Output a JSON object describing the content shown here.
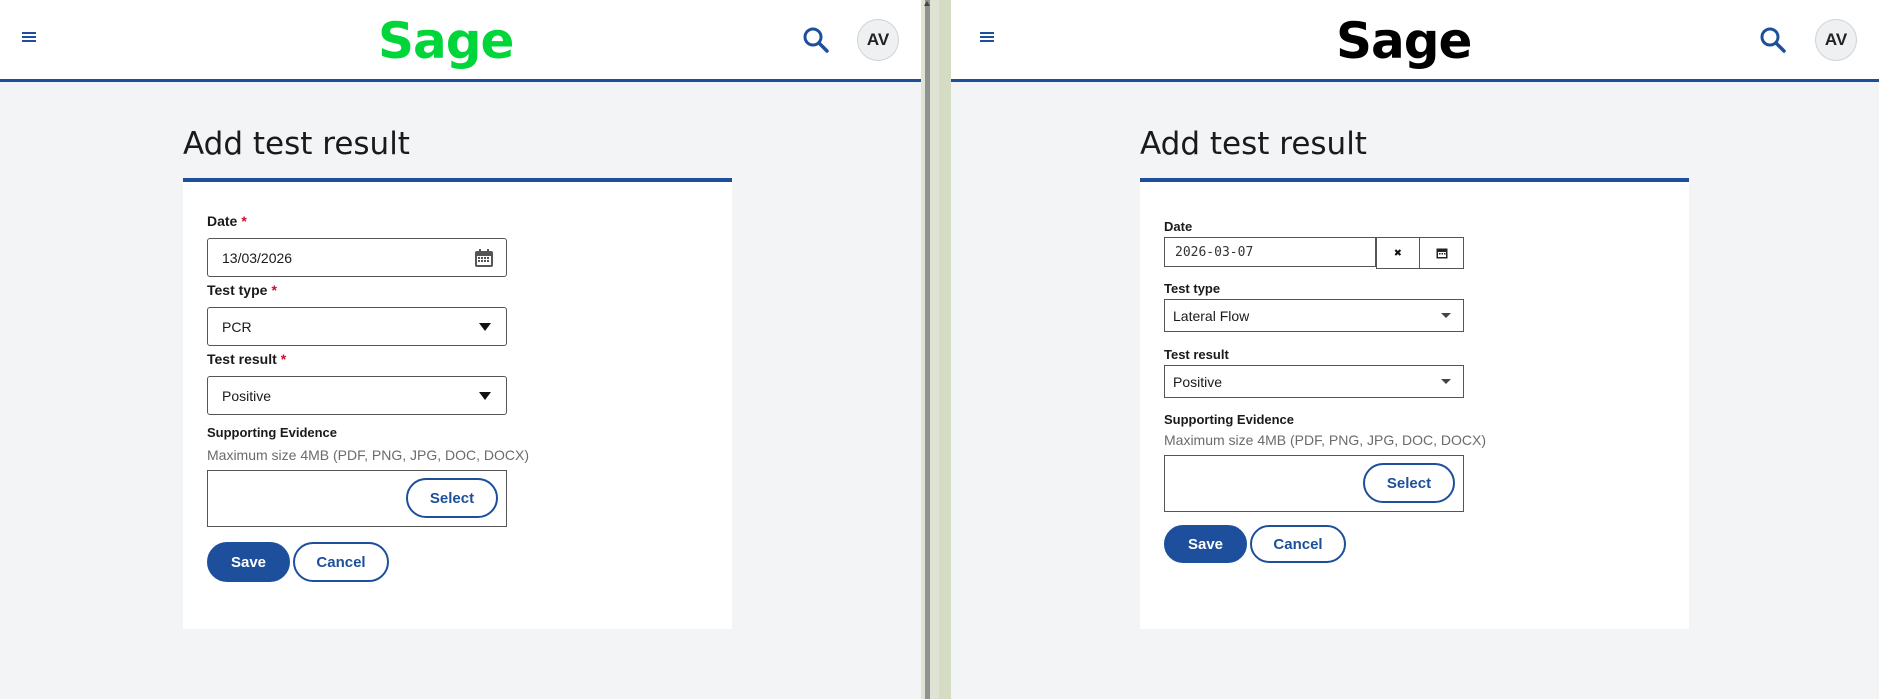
{
  "left": {
    "logo": "Sage",
    "avatar": "AV",
    "page_title": "Add test result",
    "form": {
      "date_label": "Date",
      "date_required": "*",
      "date_value": "13/03/2026",
      "test_type_label": "Test type",
      "test_type_required": "*",
      "test_type_value": "PCR",
      "test_result_label": "Test result",
      "test_result_required": "*",
      "test_result_value": "Positive",
      "evidence_label": "Supporting Evidence",
      "evidence_hint": "Maximum size 4MB (PDF, PNG, JPG, DOC, DOCX)",
      "select_label": "Select",
      "save_label": "Save",
      "cancel_label": "Cancel"
    }
  },
  "right": {
    "logo": "Sage",
    "avatar": "AV",
    "page_title": "Add test result",
    "form": {
      "date_label": "Date",
      "date_value": "2026-03-07",
      "clear_glyph": "✖",
      "test_type_label": "Test type",
      "test_type_value": "Lateral Flow",
      "test_result_label": "Test result",
      "test_result_value": "Positive",
      "evidence_label": "Supporting Evidence",
      "evidence_hint": "Maximum size 4MB (PDF, PNG, JPG, DOC, DOCX)",
      "select_label": "Select",
      "save_label": "Save",
      "cancel_label": "Cancel"
    }
  },
  "colors": {
    "brand_blue": "#1d4f9c",
    "left_logo": "#00d639",
    "right_logo": "#000000",
    "required": "#c8102e",
    "page_bg": "#f2f4f5"
  },
  "icons": [
    "menu-icon",
    "search-icon",
    "calendar-icon",
    "chevron-down-icon",
    "clear-icon"
  ]
}
